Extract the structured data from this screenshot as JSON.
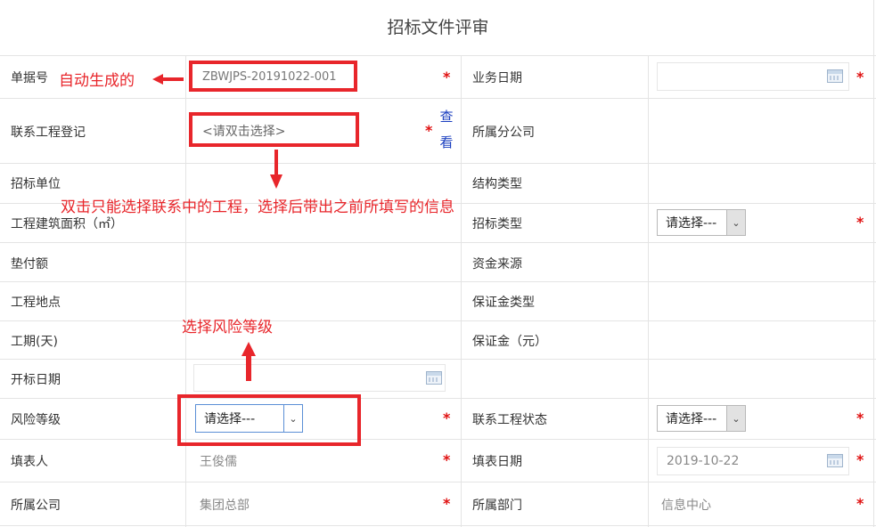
{
  "title": "招标文件评审",
  "fields": {
    "doc_no": {
      "label": "单据号",
      "value": "ZBWJPS-20191022-001"
    },
    "biz_date": {
      "label": "业务日期",
      "value": ""
    },
    "link_project": {
      "label": "联系工程登记",
      "placeholder": "<请双击选择>",
      "view_link": "查看"
    },
    "branch": {
      "label": "所属分公司"
    },
    "bid_unit": {
      "label": "招标单位"
    },
    "structure_type": {
      "label": "结构类型"
    },
    "area": {
      "label": "工程建筑面积（㎡）"
    },
    "bid_type": {
      "label": "招标类型",
      "value": "请选择---"
    },
    "advance": {
      "label": "垫付额"
    },
    "fund_source": {
      "label": "资金来源"
    },
    "site": {
      "label": "工程地点"
    },
    "deposit_type": {
      "label": "保证金类型"
    },
    "duration": {
      "label": "工期(天)"
    },
    "deposit": {
      "label": "保证金（元）"
    },
    "open_date": {
      "label": "开标日期",
      "value": ""
    },
    "risk_level": {
      "label": "风险等级",
      "value": "请选择---"
    },
    "project_status": {
      "label": "联系工程状态",
      "value": "请选择---"
    },
    "filler": {
      "label": "填表人",
      "value": "王俊儒"
    },
    "fill_date": {
      "label": "填表日期",
      "value": "2019-10-22"
    },
    "company": {
      "label": "所属公司",
      "value": "集团总部"
    },
    "department": {
      "label": "所属部门",
      "value": "信息中心"
    }
  },
  "required_mark": "*",
  "annotations": {
    "auto_generated": "自动生成的",
    "double_click_note": "双击只能选择联系中的工程，选择后带出之前所填写的信息",
    "risk_note": "选择风险等级"
  },
  "colors": {
    "annotation": "#e8262b",
    "required": "#e01010",
    "link": "#1a3ebf"
  }
}
